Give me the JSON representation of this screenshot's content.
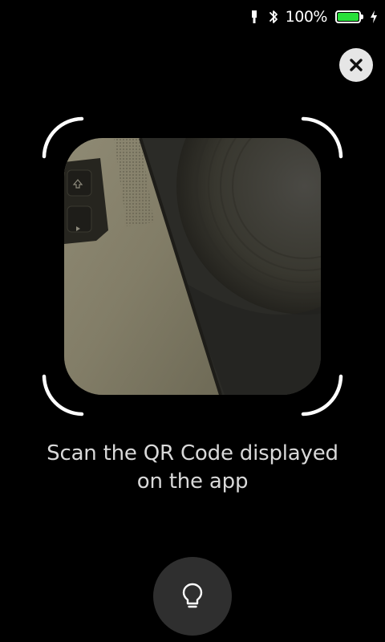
{
  "status_bar": {
    "battery_percent": "100%",
    "battery_level": 1.0,
    "battery_color": "#28e03a",
    "icons": [
      "usb-icon",
      "bluetooth-icon",
      "battery-icon",
      "charging-icon"
    ]
  },
  "close_button": {
    "icon": "close-icon"
  },
  "scanner": {
    "corner_color": "#ffffff"
  },
  "instruction": {
    "line1": "Scan the QR Code displayed",
    "line2": "on the app"
  },
  "flashlight_button": {
    "icon": "lightbulb-icon"
  }
}
